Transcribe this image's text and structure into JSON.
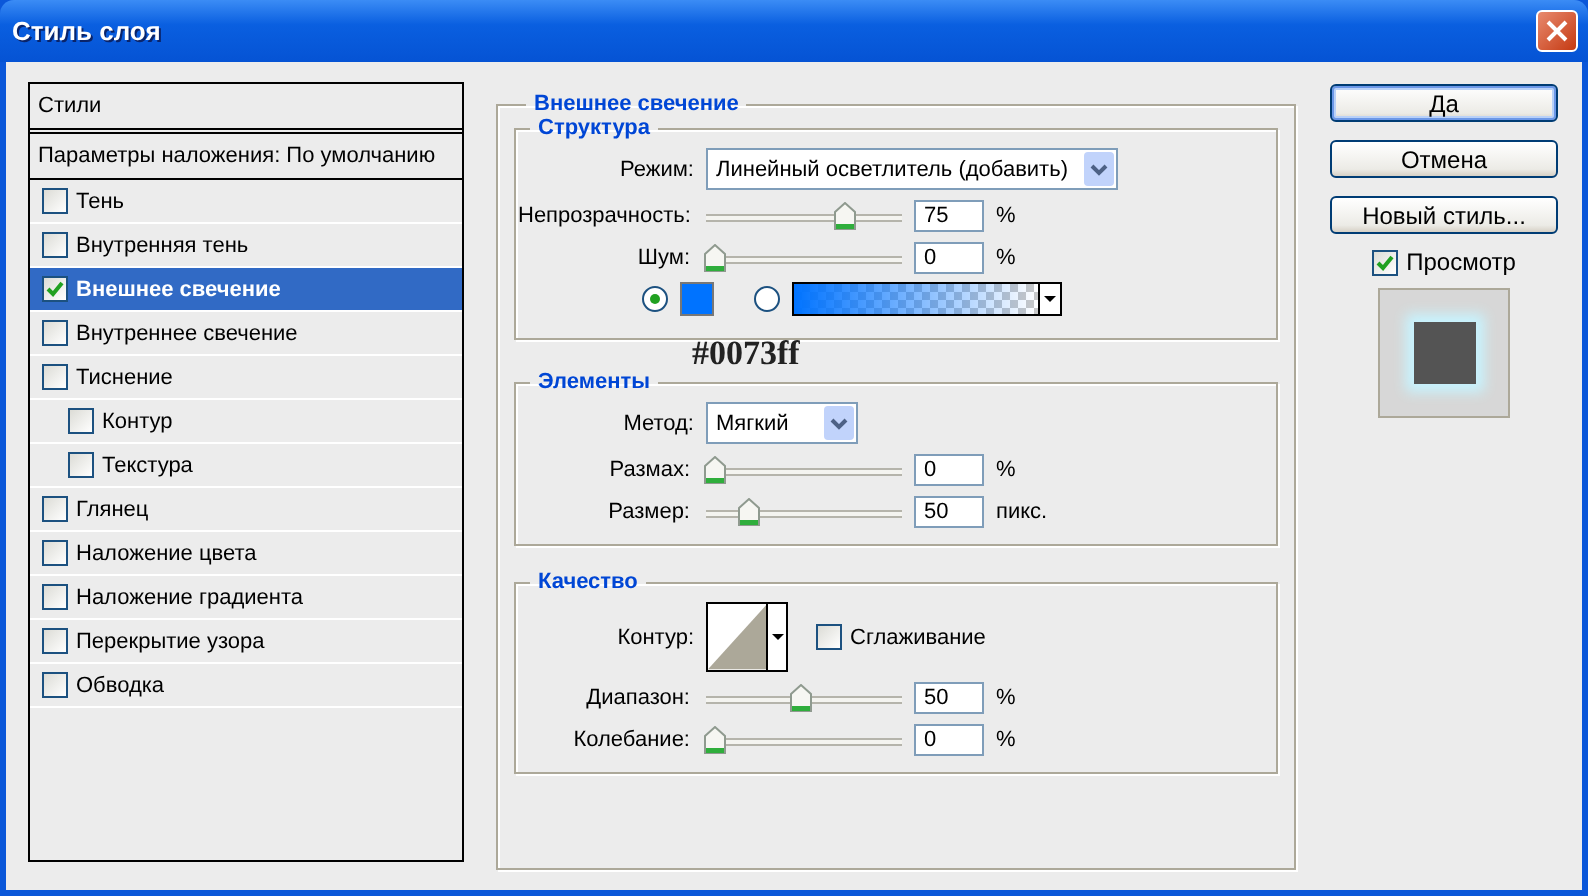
{
  "window": {
    "title": "Стиль слоя"
  },
  "styles_panel": {
    "header": "Стили",
    "blending": "Параметры наложения: По умолчанию",
    "items": [
      {
        "label": "Тень",
        "checked": false,
        "selected": false
      },
      {
        "label": "Внутренняя тень",
        "checked": false,
        "selected": false
      },
      {
        "label": "Внешнее свечение",
        "checked": true,
        "selected": true
      },
      {
        "label": "Внутреннее свечение",
        "checked": false,
        "selected": false
      },
      {
        "label": "Тиснение",
        "checked": false,
        "selected": false,
        "children": [
          {
            "label": "Контур",
            "checked": false,
            "selected": false
          },
          {
            "label": "Текстура",
            "checked": false,
            "selected": false
          }
        ]
      },
      {
        "label": "Глянец",
        "checked": false,
        "selected": false
      },
      {
        "label": "Наложение цвета",
        "checked": false,
        "selected": false
      },
      {
        "label": "Наложение градиента",
        "checked": false,
        "selected": false
      },
      {
        "label": "Перекрытие узора",
        "checked": false,
        "selected": false
      },
      {
        "label": "Обводка",
        "checked": false,
        "selected": false
      }
    ]
  },
  "outer_glow": {
    "title": "Внешнее свечение",
    "structure": {
      "title": "Структура",
      "mode_label": "Режим:",
      "mode": "Линейный осветлитель (добавить)",
      "sliders": [
        {
          "label": "Непрозрачность:",
          "level": 0.75,
          "value": "75",
          "unit": "%"
        },
        {
          "label": "Шум:",
          "level": 0,
          "value": "0",
          "unit": "%"
        }
      ],
      "fill": [
        {
          "kind": "color",
          "selected": true,
          "color": "#0073ff"
        },
        {
          "kind": "gradient",
          "selected": false,
          "color": "#0073ff"
        }
      ]
    },
    "annotation": "#0073ff",
    "elements": {
      "title": "Элементы",
      "method_label": "Метод:",
      "method": "Мягкий",
      "sliders": [
        {
          "label": "Размах:",
          "level": 0,
          "value": "0",
          "unit": "%"
        },
        {
          "label": "Размер:",
          "level": 0.2,
          "value": "50",
          "unit": "пикс."
        }
      ]
    },
    "quality": {
      "title": "Качество",
      "contour_label": "Контур:",
      "antialias": {
        "label": "Сглаживание",
        "checked": false
      },
      "sliders": [
        {
          "label": "Диапазон:",
          "level": 0.5,
          "value": "50",
          "unit": "%"
        },
        {
          "label": "Колебание:",
          "level": 0,
          "value": "0",
          "unit": "%"
        }
      ]
    }
  },
  "buttons": [
    {
      "label": "Да",
      "default": true
    },
    {
      "label": "Отмена",
      "default": false
    },
    {
      "label": "Новый стиль...",
      "default": false
    }
  ],
  "preview": {
    "label": "Просмотр",
    "checked": true
  }
}
